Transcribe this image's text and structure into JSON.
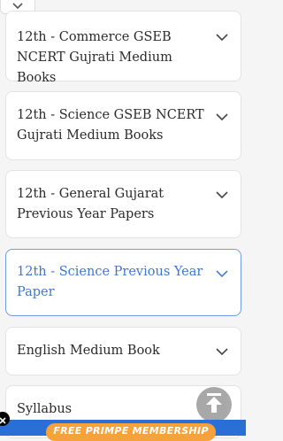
{
  "icons": {
    "collapse": "chevron-down-icon",
    "accordion_toggle": "chevron-down-icon",
    "scroll_top": "arrow-up-icon",
    "close": "close-icon"
  },
  "colors": {
    "active_text": "#3f78d1",
    "active_border": "#6e9de8",
    "promo_bg": "#f6a23c",
    "bottom_bar": "#2a6fd6"
  },
  "accordion": {
    "items": [
      {
        "label": "12th - Commerce GSEB NCERT Gujrati Medium Books"
      },
      {
        "label": "12th - Science GSEB NCERT Gujrati Medium Books"
      },
      {
        "label": "12th - General Gujarat Previous Year Papers"
      },
      {
        "label": "12th - Science Previous Year Paper"
      },
      {
        "label": "English Medium Book"
      },
      {
        "label": "Syllabus"
      }
    ]
  },
  "promo": {
    "label": "FREE PRIMPE MEMBERSHIP"
  }
}
